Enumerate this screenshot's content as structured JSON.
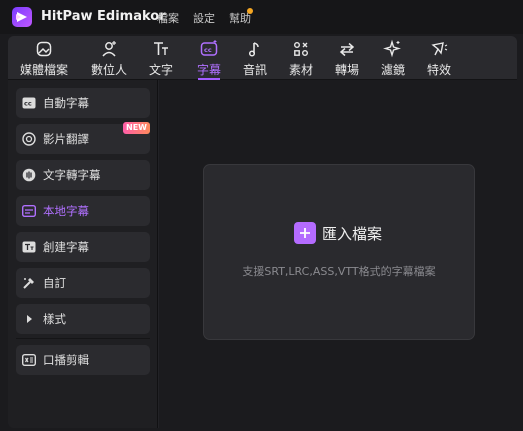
{
  "titlebar": {
    "app_name": "HitPaw Edimakor",
    "menu": [
      "檔案",
      "設定",
      "幫助"
    ]
  },
  "toolbar": {
    "tools": [
      {
        "label": "媒體檔案",
        "icon": "media-icon"
      },
      {
        "label": "數位人",
        "icon": "avatar-icon"
      },
      {
        "label": "文字",
        "icon": "text-icon"
      },
      {
        "label": "字幕",
        "icon": "subtitle-icon"
      },
      {
        "label": "音訊",
        "icon": "audio-icon"
      },
      {
        "label": "素材",
        "icon": "assets-icon"
      },
      {
        "label": "轉場",
        "icon": "transition-icon"
      },
      {
        "label": "濾鏡",
        "icon": "filter-icon"
      },
      {
        "label": "特效",
        "icon": "effects-icon"
      }
    ],
    "active_index": 3
  },
  "sidebar": {
    "items": [
      {
        "label": "自動字幕",
        "icon": "cc-icon"
      },
      {
        "label": "影片翻譯",
        "icon": "translate-icon",
        "badge": "NEW"
      },
      {
        "label": "文字轉字幕",
        "icon": "speech-icon"
      },
      {
        "label": "本地字幕",
        "icon": "local-subtitle-icon"
      },
      {
        "label": "創建字幕",
        "icon": "create-subtitle-icon"
      },
      {
        "label": "自訂",
        "icon": "custom-icon"
      },
      {
        "label": "樣式",
        "icon": "caret-right-icon"
      },
      {
        "label": "口播剪輯",
        "icon": "voice-edit-icon"
      }
    ],
    "active_index": 3
  },
  "dropzone": {
    "button_label": "匯入檔案",
    "hint": "支援SRT,LRC,ASS,VTT格式的字幕檔案"
  },
  "colors": {
    "accent": "#b46bff",
    "background": "#1b1b1e",
    "panel": "#2a2a2e"
  }
}
